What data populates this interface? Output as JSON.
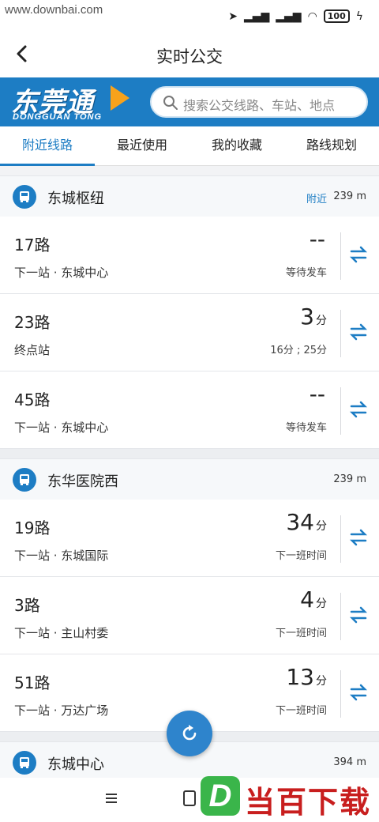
{
  "watermark_top": "www.downbai.com",
  "status": {
    "battery": "100"
  },
  "appbar": {
    "title": "实时公交"
  },
  "brand": {
    "logo_cn": "东莞通",
    "logo_en": "DONGGUAN TONG"
  },
  "search": {
    "placeholder": "搜索公交线路、车站、地点"
  },
  "tabs": [
    {
      "label": "附近线路",
      "active": true
    },
    {
      "label": "最近使用"
    },
    {
      "label": "我的收藏"
    },
    {
      "label": "路线规划"
    }
  ],
  "stations": [
    {
      "name": "东城枢纽",
      "nearby": "附近",
      "distance": "239 m",
      "routes": [
        {
          "name": "17路",
          "next": "下一站 · 东城中心",
          "eta": "--",
          "unit": "",
          "sub": "等待发车"
        },
        {
          "name": "23路",
          "next": "终点站",
          "eta": "3",
          "unit": "分",
          "sub": "16分 ; 25分"
        },
        {
          "name": "45路",
          "next": "下一站 · 东城中心",
          "eta": "--",
          "unit": "",
          "sub": "等待发车"
        }
      ]
    },
    {
      "name": "东华医院西",
      "nearby": "",
      "distance": "239 m",
      "routes": [
        {
          "name": "19路",
          "next": "下一站 · 东城国际",
          "eta": "34",
          "unit": "分",
          "sub": "下一班时间"
        },
        {
          "name": "3路",
          "next": "下一站 · 主山村委",
          "eta": "4",
          "unit": "分",
          "sub": "下一班时间"
        },
        {
          "name": "51路",
          "next": "下一站 · 万达广场",
          "eta": "13",
          "unit": "分",
          "sub": "下一班时间"
        }
      ]
    },
    {
      "name": "东城中心",
      "nearby": "",
      "distance": "394 m",
      "routes": []
    }
  ],
  "watermark_bottom": {
    "letter": "D",
    "text": "当百下载"
  },
  "colors": {
    "accent": "#1d7dc4",
    "brand_bg": "#1d7dc4",
    "logo_arrow": "#f7a21b",
    "watermark_green": "#3ab54a",
    "watermark_red": "#c81e1e"
  }
}
